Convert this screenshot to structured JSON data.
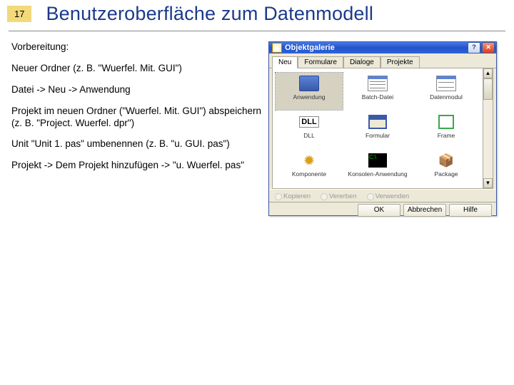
{
  "slide": {
    "number": "17",
    "title": "Benutzeroberfläche zum Datenmodell"
  },
  "steps": {
    "heading": "Vorbereitung:",
    "s1": "Neuer Ordner (z. B. \"Wuerfel. Mit. GUI\")",
    "s2": "Datei -> Neu -> Anwendung",
    "s3": "Projekt im neuen Ordner (\"Wuerfel. Mit. GUI\") abspeichern (z. B. \"Project. Wuerfel. dpr\")",
    "s4": "Unit \"Unit 1. pas\" umbenennen (z. B. \"u. GUI. pas\")",
    "s5": "Projekt -> Dem Projekt hinzufügen -> \"u. Wuerfel. pas\""
  },
  "dialog": {
    "title": "Objektgalerie",
    "tabs": [
      "Neu",
      "Formulare",
      "Dialoge",
      "Projekte"
    ],
    "items": [
      {
        "label": "Anwendung",
        "selected": true
      },
      {
        "label": "Batch-Datei"
      },
      {
        "label": "Datenmodul"
      },
      {
        "label": "DLL"
      },
      {
        "label": "Formular"
      },
      {
        "label": "Frame"
      },
      {
        "label": "Komponente"
      },
      {
        "label": "Konsolen-Anwendung"
      },
      {
        "label": "Package"
      }
    ],
    "radios": {
      "copy": "Kopieren",
      "inherit": "Vererben",
      "use": "Verwenden"
    },
    "buttons": {
      "ok": "OK",
      "cancel": "Abbrechen",
      "help": "Hilfe"
    }
  },
  "colors": {
    "title": "#1b3a8a",
    "badge": "#f2d97a",
    "xp_blue": "#2353c8",
    "xp_face": "#ece9d8"
  }
}
